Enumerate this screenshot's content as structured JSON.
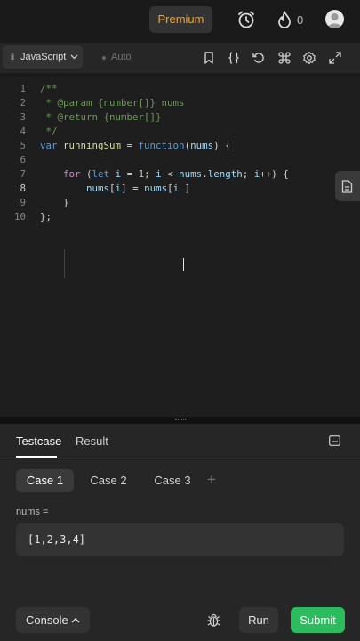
{
  "topbar": {
    "premium_label": "Premium",
    "streak_count": "0"
  },
  "toolbar": {
    "language": "JavaScript",
    "auto_label": "Auto"
  },
  "editor": {
    "line_numbers": [
      "1",
      "2",
      "3",
      "4",
      "5",
      "6",
      "7",
      "8",
      "9",
      "10"
    ],
    "lines": [
      [
        {
          "t": "/**",
          "c": "cm"
        }
      ],
      [
        {
          "t": " * @param {number[]} nums",
          "c": "cm"
        }
      ],
      [
        {
          "t": " * @return {number[]}",
          "c": "cm"
        }
      ],
      [
        {
          "t": " */",
          "c": "cm"
        }
      ],
      [
        {
          "t": "var ",
          "c": "kw2"
        },
        {
          "t": "runningSum",
          "c": "fn"
        },
        {
          "t": " = ",
          "c": "tx"
        },
        {
          "t": "function",
          "c": "kw2"
        },
        {
          "t": "(",
          "c": "tx"
        },
        {
          "t": "nums",
          "c": "id"
        },
        {
          "t": ") {",
          "c": "tx"
        }
      ],
      [],
      [
        {
          "t": "    ",
          "c": "tx"
        },
        {
          "t": "for",
          "c": "kw"
        },
        {
          "t": " (",
          "c": "tx"
        },
        {
          "t": "let",
          "c": "kw2"
        },
        {
          "t": " ",
          "c": "tx"
        },
        {
          "t": "i",
          "c": "id"
        },
        {
          "t": " = ",
          "c": "tx"
        },
        {
          "t": "1",
          "c": "num"
        },
        {
          "t": "; ",
          "c": "tx"
        },
        {
          "t": "i",
          "c": "id"
        },
        {
          "t": " < ",
          "c": "tx"
        },
        {
          "t": "nums",
          "c": "id"
        },
        {
          "t": ".",
          "c": "tx"
        },
        {
          "t": "length",
          "c": "id"
        },
        {
          "t": "; ",
          "c": "tx"
        },
        {
          "t": "i",
          "c": "id"
        },
        {
          "t": "++) {",
          "c": "tx"
        }
      ],
      [
        {
          "t": "        ",
          "c": "tx"
        },
        {
          "t": "nums",
          "c": "id"
        },
        {
          "t": "[",
          "c": "tx"
        },
        {
          "t": "i",
          "c": "id"
        },
        {
          "t": "] = ",
          "c": "tx"
        },
        {
          "t": "nums",
          "c": "id"
        },
        {
          "t": "[",
          "c": "tx"
        },
        {
          "t": "i",
          "c": "id"
        },
        {
          "t": " ]",
          "c": "tx"
        }
      ],
      [
        {
          "t": "    }",
          "c": "tx"
        }
      ],
      [
        {
          "t": "};",
          "c": "tx"
        }
      ]
    ],
    "active_line": 8
  },
  "panel": {
    "tabs": [
      {
        "label": "Testcase",
        "active": true
      },
      {
        "label": "Result",
        "active": false
      }
    ],
    "cases": [
      {
        "label": "Case 1",
        "active": true
      },
      {
        "label": "Case 2",
        "active": false
      },
      {
        "label": "Case 3",
        "active": false
      }
    ],
    "add_case_label": "+",
    "field_label": "nums =",
    "field_value": "[1,2,3,4]",
    "console_label": "Console",
    "run_label": "Run",
    "submit_label": "Submit"
  },
  "colors": {
    "accent_premium": "#ffa116",
    "submit_green": "#2cbb5d"
  },
  "icons": [
    "alarm-clock-icon",
    "fire-icon",
    "avatar",
    "lock-icon",
    "bookmark-icon",
    "braces-icon",
    "reset-icon",
    "command-icon",
    "settings-icon",
    "fullscreen-icon",
    "file-icon",
    "layout-icon",
    "chevron-up-icon",
    "bug-icon"
  ]
}
